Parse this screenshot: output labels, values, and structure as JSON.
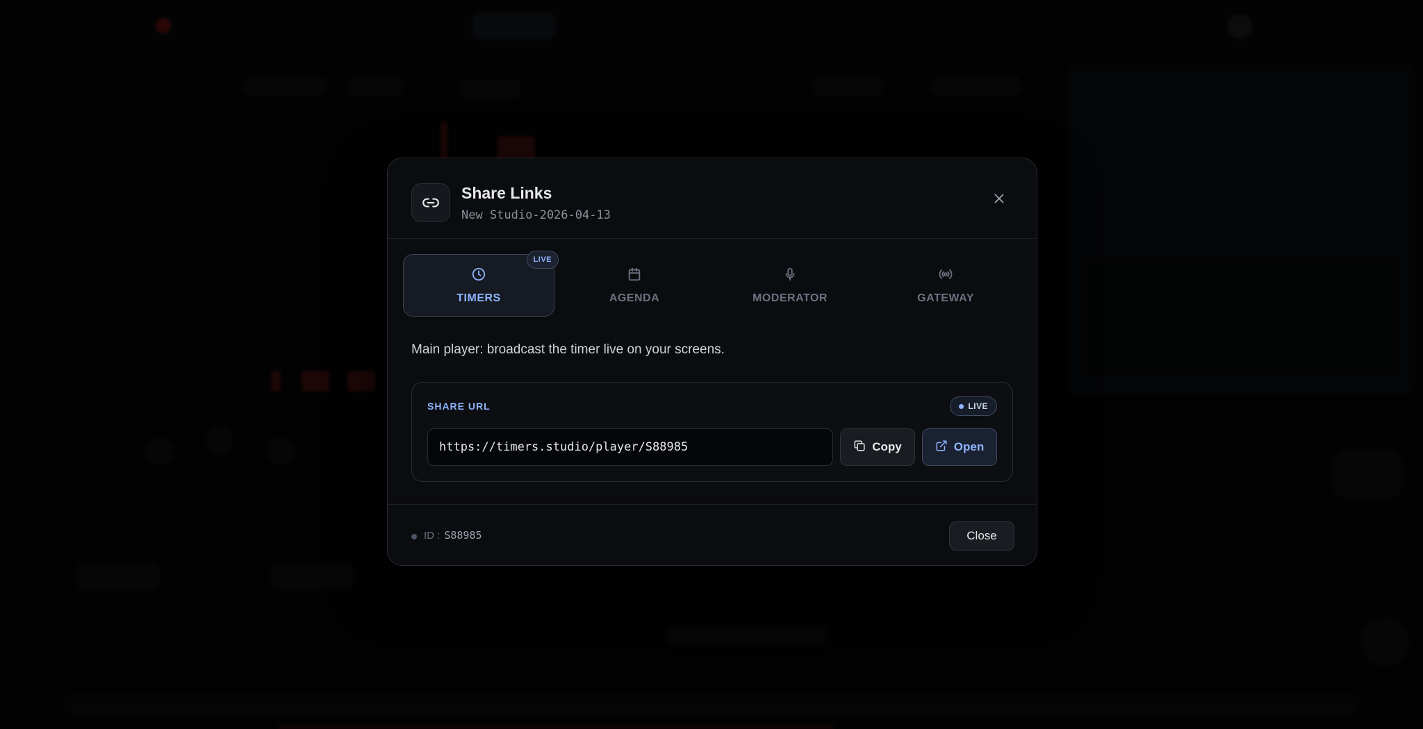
{
  "modal": {
    "title": "Share Links",
    "subtitle": "New Studio-2026-04-13",
    "close_icon": "close-icon",
    "header_icon": "link-icon"
  },
  "tabs": [
    {
      "label": "TIMERS",
      "icon": "clock-icon",
      "active": true,
      "badge": "LIVE"
    },
    {
      "label": "AGENDA",
      "icon": "calendar-icon",
      "active": false
    },
    {
      "label": "MODERATOR",
      "icon": "microphone-icon",
      "active": false
    },
    {
      "label": "GATEWAY",
      "icon": "broadcast-icon",
      "active": false
    }
  ],
  "description": "Main player: broadcast the timer live on your screens.",
  "share": {
    "label": "SHARE URL",
    "status": "LIVE",
    "url": "https://timers.studio/player/S88985",
    "copy_label": "Copy",
    "open_label": "Open"
  },
  "footer": {
    "id_label": "ID :",
    "id_value": "S88985",
    "close_label": "Close"
  },
  "colors": {
    "accent": "#8fb4ff",
    "modal_bg": "#0b0c0f",
    "brand_red": "#b91c1c"
  }
}
